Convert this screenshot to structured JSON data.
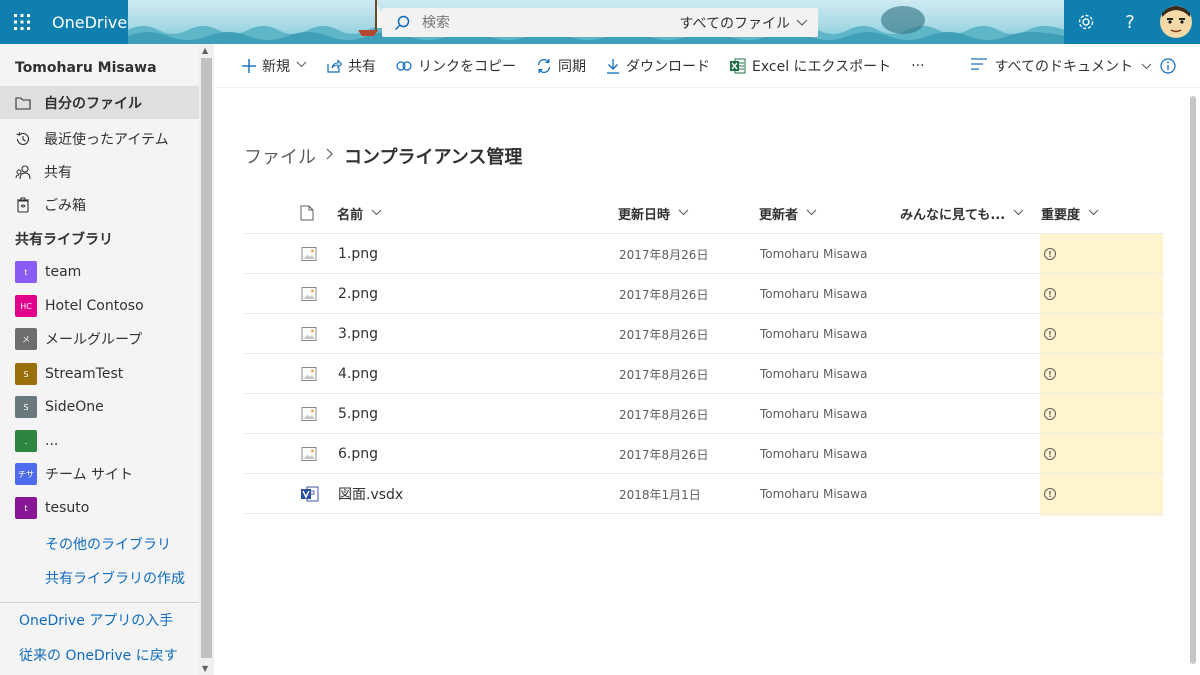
{
  "header": {
    "brand": "OneDrive",
    "search_placeholder": "検索",
    "search_scope": "すべてのファイル",
    "settings_icon": "gear-icon",
    "help_label": "?",
    "accent": "#0f7fb0"
  },
  "sidebar": {
    "user_name": "Tomoharu Misawa",
    "items": [
      {
        "label": "自分のファイル",
        "icon": "folder-icon",
        "active": true
      },
      {
        "label": "最近使ったアイテム",
        "icon": "history-icon"
      },
      {
        "label": "共有",
        "icon": "people-icon"
      },
      {
        "label": "ごみ箱",
        "icon": "recycle-bin-icon"
      }
    ],
    "shared_heading": "共有ライブラリ",
    "libraries": [
      {
        "label": "team",
        "badge": "t",
        "color": "#8a5cf5"
      },
      {
        "label": "Hotel Contoso",
        "badge": "HC",
        "color": "#e3008c"
      },
      {
        "label": "メールグループ",
        "badge": "メ",
        "color": "#6e6e6e"
      },
      {
        "label": "StreamTest",
        "badge": "S",
        "color": "#986f0b"
      },
      {
        "label": "SideOne",
        "badge": "S",
        "color": "#69797e"
      },
      {
        "label": "...",
        "badge": ".",
        "color": "#2e8540"
      },
      {
        "label": "チーム サイト",
        "badge": "チサ",
        "color": "#4f6bed"
      },
      {
        "label": "tesuto",
        "badge": "t",
        "color": "#881798"
      }
    ],
    "more_libraries": "その他のライブラリ",
    "create_library": "共有ライブラリの作成",
    "get_app": "OneDrive アプリの入手",
    "classic": "従来の OneDrive に戻す"
  },
  "commandbar": {
    "new": "新規",
    "share": "共有",
    "copy_link": "リンクをコピー",
    "sync": "同期",
    "download": "ダウンロード",
    "export_excel": "Excel にエクスポート",
    "more": "···",
    "view": "すべてのドキュメント"
  },
  "breadcrumb": {
    "root": "ファイル",
    "current": "コンプライアンス管理"
  },
  "table": {
    "columns": {
      "name": "名前",
      "modified": "更新日時",
      "modified_by": "更新者",
      "custom": "みんなに見ても...",
      "importance": "重要度"
    },
    "rows": [
      {
        "name": "1.png",
        "modified": "2017年8月26日",
        "by": "Tomoharu Misawa",
        "type": "image"
      },
      {
        "name": "2.png",
        "modified": "2017年8月26日",
        "by": "Tomoharu Misawa",
        "type": "image"
      },
      {
        "name": "3.png",
        "modified": "2017年8月26日",
        "by": "Tomoharu Misawa",
        "type": "image"
      },
      {
        "name": "4.png",
        "modified": "2017年8月26日",
        "by": "Tomoharu Misawa",
        "type": "image"
      },
      {
        "name": "5.png",
        "modified": "2017年8月26日",
        "by": "Tomoharu Misawa",
        "type": "image"
      },
      {
        "name": "6.png",
        "modified": "2017年8月26日",
        "by": "Tomoharu Misawa",
        "type": "image"
      },
      {
        "name": "図面.vsdx",
        "modified": "2018年1月1日",
        "by": "Tomoharu Misawa",
        "type": "visio"
      }
    ],
    "importance_color": "#fff4ce"
  }
}
